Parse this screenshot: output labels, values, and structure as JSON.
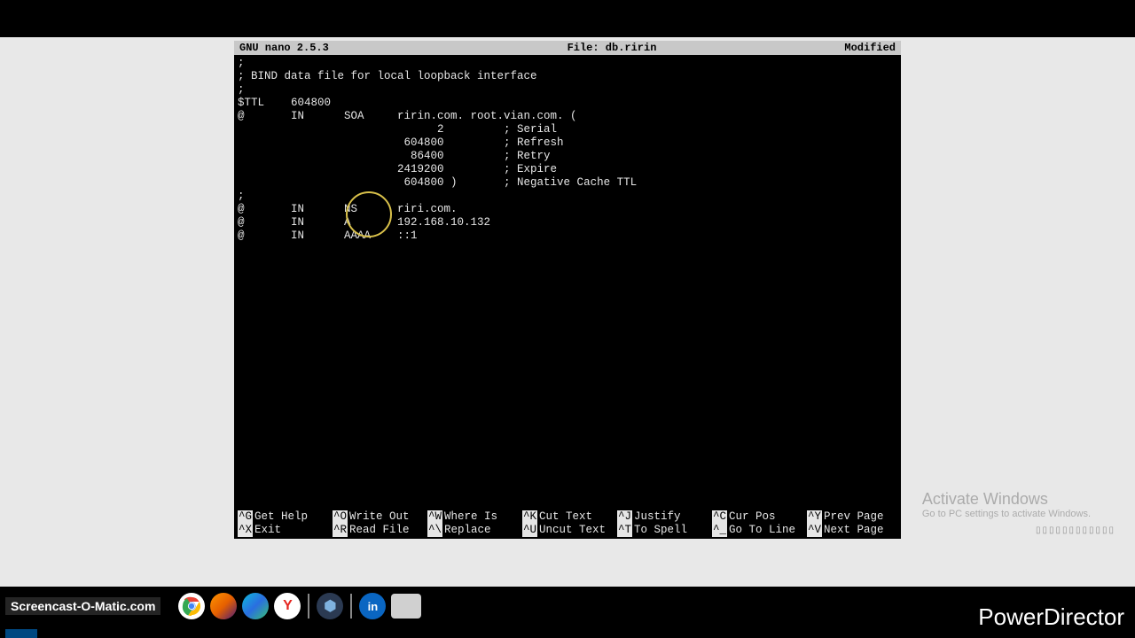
{
  "editor": {
    "app_name": "GNU nano 2.5.3",
    "file_label": "File: db.ririn",
    "modified": "Modified"
  },
  "file_content": {
    "line1": ";",
    "line2": "; BIND data file for local loopback interface",
    "line3": ";",
    "line4": "$TTL    604800",
    "line5": "@       IN      SOA     ririn.com. root.vian.com. (",
    "line6": "                              2         ; Serial",
    "line7": "                         604800         ; Refresh",
    "line8": "                          86400         ; Retry",
    "line9": "                        2419200         ; Expire",
    "line10": "                         604800 )       ; Negative Cache TTL",
    "line11": ";",
    "line12": "@       IN      NS      riri.com.",
    "line13": "@       IN      A       192.168.10.132",
    "line14": "@       IN      AAAA    ::1"
  },
  "shortcuts_row1": [
    {
      "key": "^G",
      "label": "Get Help"
    },
    {
      "key": "^O",
      "label": "Write Out"
    },
    {
      "key": "^W",
      "label": "Where Is"
    },
    {
      "key": "^K",
      "label": "Cut Text"
    },
    {
      "key": "^J",
      "label": "Justify"
    },
    {
      "key": "^C",
      "label": "Cur Pos"
    },
    {
      "key": "^Y",
      "label": "Prev Page"
    }
  ],
  "shortcuts_row2": [
    {
      "key": "^X",
      "label": "Exit"
    },
    {
      "key": "^R",
      "label": "Read File"
    },
    {
      "key": "^\\",
      "label": "Replace"
    },
    {
      "key": "^U",
      "label": "Uncut Text"
    },
    {
      "key": "^T",
      "label": "To Spell"
    },
    {
      "key": "^_",
      "label": "Go To Line"
    },
    {
      "key": "^V",
      "label": "Next Page"
    }
  ],
  "watermarks": {
    "screencast": "Screencast-O-Matic.com",
    "powerdirector": "PowerDirector",
    "activate_title": "Activate Windows",
    "activate_sub": "Go to PC settings to activate Windows."
  },
  "taskbar": {
    "yandex_glyph": "Y",
    "vbox_glyph": "⬢",
    "linkedin_glyph": "in",
    "hint": ""
  }
}
